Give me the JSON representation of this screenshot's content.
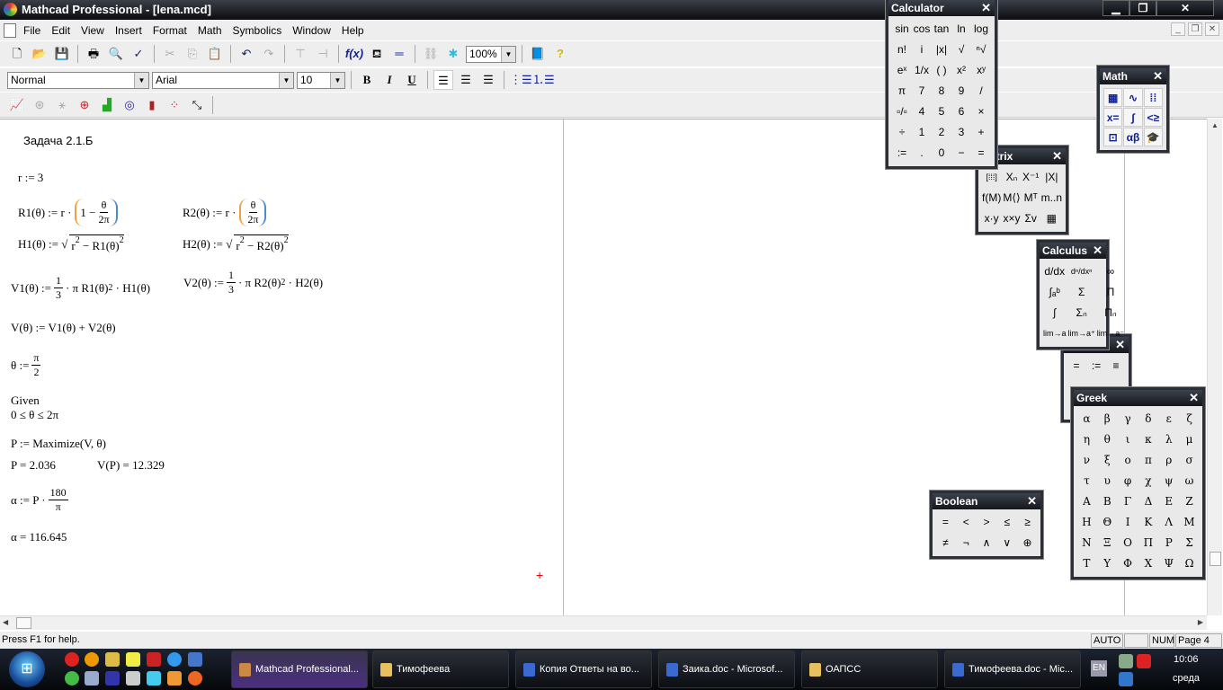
{
  "window": {
    "title": "Mathcad Professional - [lena.mcd]",
    "min": "▁",
    "max": "❐",
    "close": "✕"
  },
  "menu": [
    "File",
    "Edit",
    "View",
    "Insert",
    "Format",
    "Math",
    "Symbolics",
    "Window",
    "Help"
  ],
  "doc_controls": {
    "min": "_",
    "max": "❐",
    "close": "✕"
  },
  "toolbar": {
    "zoom": "100%"
  },
  "format_toolbar": {
    "style": "Normal",
    "font": "Arial",
    "size": "10",
    "bold": "B",
    "italic": "I",
    "underline": "U"
  },
  "worksheet": {
    "heading": "Задача 2.1.Б",
    "r_def": "r := 3",
    "R1": {
      "lhs": "R1(θ) := r ·",
      "inner": "1 −",
      "num": "θ",
      "den": "2π"
    },
    "R2": {
      "lhs": "R2(θ) := r ·",
      "num": "θ",
      "den": "2π"
    },
    "H1": {
      "lhs": "H1(θ) :=",
      "rad_a": "r",
      "exp": "2",
      "rad_b": "− R1(θ)"
    },
    "H2": {
      "lhs": "H2(θ) :=",
      "rad_a": "r",
      "exp": "2",
      "rad_b": "− R2(θ)"
    },
    "V1": {
      "lhs": "V1(θ) :=",
      "num": "1",
      "den": "3",
      "mid": "· π R1(θ)",
      "exp": "2",
      "rest": "· H1(θ)"
    },
    "V2": {
      "lhs": "V2(θ) :=",
      "num": "1",
      "den": "3",
      "mid": "· π R2(θ)",
      "exp": "2",
      "rest": "· H2(θ)"
    },
    "V": "V(θ) := V1(θ) + V2(θ)",
    "theta": {
      "lhs": "θ :=",
      "num": "π",
      "den": "2"
    },
    "given": "Given",
    "constraint": "0 ≤ θ ≤ 2π",
    "P_def": "P := Maximize(V, θ)",
    "P_result": "P = 2.036",
    "VP_result": "V(P) = 12.329",
    "alpha_def": {
      "lhs": "α := P ·",
      "num": "180",
      "den": "π"
    },
    "alpha_result": "α = 116.645"
  },
  "status": {
    "help": "Press F1 for help.",
    "mode": "AUTO",
    "num": "NUM",
    "page": "Page 4"
  },
  "taskbar": {
    "start": "⊞",
    "tasks": [
      {
        "label": "Mathcad Professional...",
        "active": true,
        "color": "#c84"
      },
      {
        "label": "Тимофеева",
        "color": "#e8c060"
      },
      {
        "label": "Копия Ответы на во...",
        "color": "#3a6ad0"
      },
      {
        "label": "Заика.doc - Microsof...",
        "color": "#3a6ad0"
      },
      {
        "label": "ОАПСС",
        "color": "#e8c060"
      },
      {
        "label": "Тимофеева.doc - Mic...",
        "color": "#3a6ad0"
      }
    ],
    "lang": "EN",
    "time": "10:06",
    "day": "среда"
  },
  "palettes": {
    "calculator": {
      "title": "Calculator",
      "keys": [
        "sin",
        "cos",
        "tan",
        "ln",
        "log",
        "n!",
        "i",
        "|x|",
        "√",
        "ⁿ√",
        "eˣ",
        "1/x",
        "( )",
        "x²",
        "xʸ",
        "π",
        "7",
        "8",
        "9",
        "/",
        "▫/▫",
        "4",
        "5",
        "6",
        "×",
        "÷",
        "1",
        "2",
        "3",
        "+",
        ":=",
        ".",
        "0",
        "−",
        "="
      ]
    },
    "math": {
      "title": "Math",
      "icons": [
        "calculator-toolbar-icon",
        "graph-toolbar-icon",
        "matrix-toolbar-icon",
        "evaluation-toolbar-icon",
        "calculus-toolbar-icon",
        "boolean-toolbar-icon",
        "programming-toolbar-icon",
        "greek-toolbar-icon",
        "symbolic-toolbar-icon"
      ],
      "glyphs": [
        "▦",
        "∿",
        "⁞⁞",
        "x=",
        "∫",
        "<≥",
        "⊡",
        "αβ",
        "🎓"
      ]
    },
    "matrix": {
      "title": "Matrix",
      "keys": [
        "[⁞⁞⁞]",
        "Xₙ",
        "X⁻¹",
        "|X|",
        "f(M)",
        "M⟨⟩",
        "Mᵀ",
        "m..n",
        "x·y",
        "x×y",
        "Σv",
        "▦"
      ]
    },
    "calculus": {
      "title": "Calculus",
      "keys": [
        "d/dx",
        "dⁿ/dxⁿ",
        "∞",
        "∫ₐᵇ",
        "Σ",
        "Π",
        "∫",
        "Σₙ",
        "Πₙ",
        "lim→a",
        "lim→a⁺",
        "lim→a⁻"
      ]
    },
    "evaluation": {
      "keys": [
        "=",
        ":=",
        "≡"
      ]
    },
    "greek": {
      "title": "Greek",
      "keys": [
        "α",
        "β",
        "γ",
        "δ",
        "ε",
        "ζ",
        "η",
        "θ",
        "ι",
        "κ",
        "λ",
        "μ",
        "ν",
        "ξ",
        "ο",
        "π",
        "ρ",
        "σ",
        "τ",
        "υ",
        "φ",
        "χ",
        "ψ",
        "ω",
        "Α",
        "Β",
        "Γ",
        "Δ",
        "Ε",
        "Ζ",
        "Η",
        "Θ",
        "Ι",
        "Κ",
        "Λ",
        "Μ",
        "Ν",
        "Ξ",
        "Ο",
        "Π",
        "Ρ",
        "Σ",
        "Τ",
        "Υ",
        "Φ",
        "Χ",
        "Ψ",
        "Ω"
      ]
    },
    "boolean": {
      "title": "Boolean",
      "keys": [
        "=",
        "<",
        ">",
        "≤",
        "≥",
        "≠",
        "¬",
        "∧",
        "∨",
        "⊕"
      ]
    },
    "close": "✕"
  }
}
